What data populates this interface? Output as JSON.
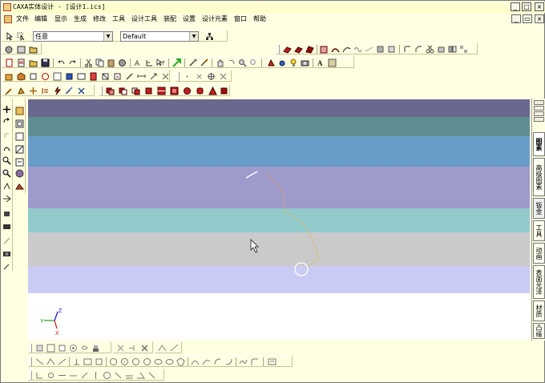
{
  "window": {
    "title": "CAXA实体设计 - [设计1.ics]",
    "minimize": "_",
    "maximize": "□",
    "close": "×"
  },
  "menu": {
    "items": [
      "文件",
      "编辑",
      "显示",
      "生成",
      "修改",
      "工具",
      "设计工具",
      "装配",
      "设置",
      "设计元素",
      "窗口",
      "帮助"
    ],
    "doc_minimize": "_",
    "doc_restore": "▭",
    "doc_close": "×"
  },
  "selectors": {
    "filter_value": "任意",
    "config_value": "Default"
  },
  "side_tabs": [
    "图素",
    "高级图素",
    "钣金",
    "工具",
    "动画",
    "表面光泽",
    "材质",
    "凸缘"
  ],
  "colors": {
    "background": "#ffffe1",
    "viewport_top": "#696990",
    "accent": "#e8b040"
  },
  "icons": {
    "axis_triad": "xyz-triad",
    "cursor": "arrow-pointer"
  },
  "triad_labels": {
    "z": "Z",
    "y": "Y",
    "x": "X"
  }
}
